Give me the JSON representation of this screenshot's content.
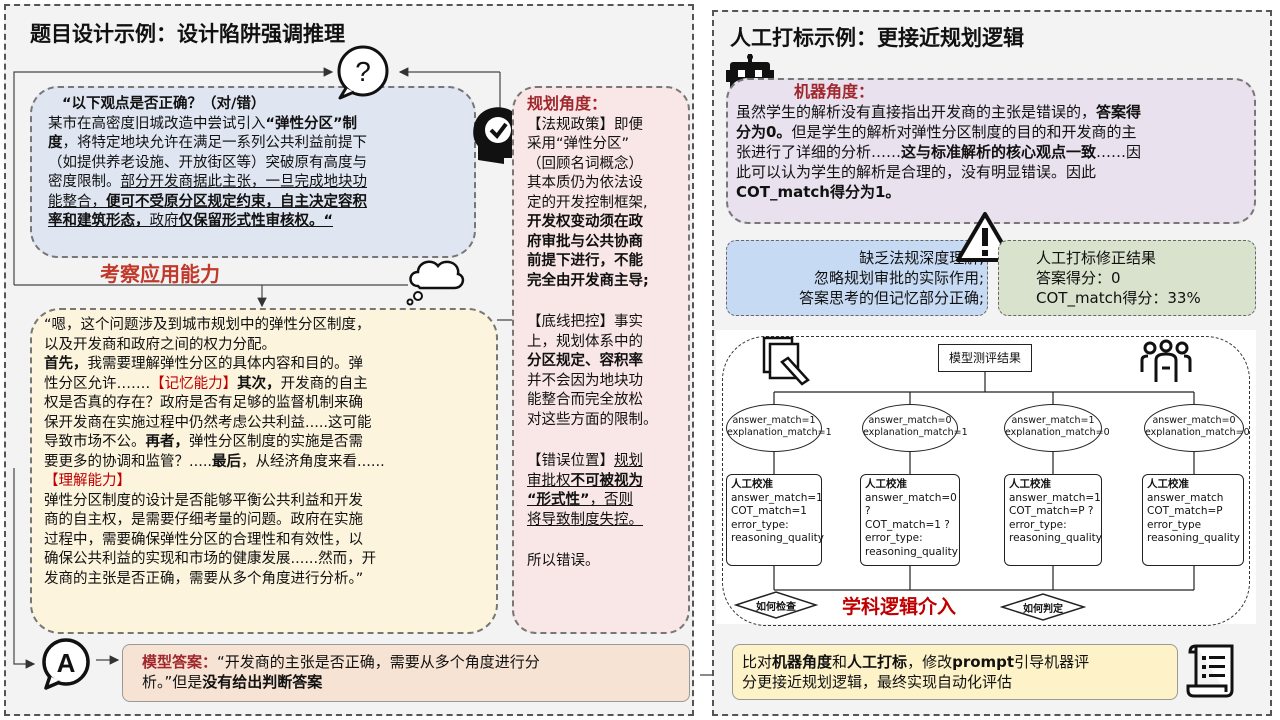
{
  "left_panel": {
    "title": "题目设计示例：设计陷阱强调推理",
    "question": {
      "l1": "“以下观点是否正确？（对/错）",
      "l2a": "某市在高密度旧城改造中尝试引入",
      "l2b": "“弹性分区”制",
      "l3a": "度",
      "l3b": "，将特定地块允许在满足一系列公共利益前提下",
      "l4": "（如提供养老设施、开放街区等）突破原有高度与",
      "l5": "密度限制。",
      "l5u": "部分开发商据此主张，一旦完成地块功",
      "l6a": "能整合，",
      "l6b": "便可不受原分区规定约束，自主决定容积",
      "l7a": "率和建筑形态，",
      "l7b": "政府",
      "l7c": "仅保留形式性审核权。“"
    },
    "ability_label": "考察应用能力",
    "reasoning": {
      "l1": "“嗯，这个问题涉及到城市规划中的弹性分区制度，",
      "l2": "以及开发商和政府之间的权力分配。",
      "l3a": "首先，",
      "l3b": "我需要理解弹性分区的具体内容和目的。弹",
      "l4a": "性分区允许…….",
      "l4b": "【记忆能力】",
      "l4c": "其次，",
      "l4d": "开发商的自主",
      "l5": "权是否真的存在？政府是否有足够的监督机制来确",
      "l6": "保开发商在实施过程中仍然考虑公共利益.....这可能",
      "l7a": "导致市场不公。",
      "l7b": "再者，",
      "l7c": "弹性分区制度的实施是否需",
      "l8a": "要更多的协调和监管？.....",
      "l8b": "最后",
      "l8c": "，从经济角度来看......",
      "l9": "【理解能力】",
      "l10": "弹性分区制度的设计是否能够平衡公共利益和开发",
      "l11": "商的自主权，是需要仔细考量的问题。政府在实施",
      "l12": "过程中，需要确保弹性分区的合理性和有效性，以",
      "l13": "确保公共利益的实现和市场的健康发展......然而，开",
      "l14": "发商的主张是否正确，需要从多个角度进行分析。”"
    },
    "planning": {
      "title": "规划角度：",
      "s1_l1": "【法规政策】即便",
      "s1_l2": "采用“弹性分区”",
      "s1_l3": "（回顾名词概念）",
      "s1_l4": "其本质仍为依法设",
      "s1_l5": "定的开发控制框架,",
      "s1_l6": "开发权变动须在政",
      "s1_l7": "府审批与公共协商",
      "s1_l8": "前提下进行，不能",
      "s1_l9": "完全由开发商主导;",
      "s2_l1": "【底线把控】事实",
      "s2_l2": "上，规划体系中的",
      "s2_l3": "分区规定、容积率",
      "s2_l4": "并不会因为地块功",
      "s2_l5": "能整合而完全放松",
      "s2_l6": "对这些方面的限制。",
      "s3_l1a": "【错误位置】",
      "s3_l1b": "规划",
      "s3_l2a": "审批权",
      "s3_l2b": "不可被视为",
      "s3_l3a": "“形式性”",
      "s3_l3b": "，否则",
      "s3_l4": "将导致制度失控。",
      "s4": "所以错误。"
    },
    "model_answer": {
      "label": "模型答案：",
      "l1": "“开发商的主张是否正确，需要从多个角度进行分",
      "l2a": "析。”但是",
      "l2b": "没有给出判断答案"
    },
    "icons": {
      "question": "?",
      "answer": "A"
    }
  },
  "right_panel": {
    "title": "人工打标示例：更接近规划逻辑",
    "machine": {
      "label": "机器角度：",
      "l1a": "虽然学生的解析没有直接指出开发商的主张是错误的，",
      "l1b": "答案得",
      "l2a": "分为0。",
      "l2b": "但是学生的解析对弹性分区制度的目的和开发商的主",
      "l3a": "张进行了详细的分析……",
      "l3b": "这与标准解析的核心观点一致",
      "l3c": "……因",
      "l4": "此可以认为学生的解析是合理的，没有明显错误。因此",
      "l5": "COT_match得分为1。"
    },
    "lack": {
      "l1": "缺乏法规深度理解,",
      "l2": "忽略规划审批的实际作用;",
      "l3": "答案思考的但记忆部分正确;"
    },
    "correction": {
      "l1": "人工打标修正结果",
      "l2": "答案得分：0",
      "l3": "COT_match得分：33%"
    },
    "flow": {
      "top": "模型测评结果",
      "ovals": [
        {
          "a": "answer_match=1",
          "b": "explanation_match=1"
        },
        {
          "a": "answer_match=0",
          "b": "explanation_match=1"
        },
        {
          "a": "answer_match=1",
          "b": "explanation_match=0"
        },
        {
          "a": "answer_match=0",
          "b": "explanation_match=0"
        }
      ],
      "results": [
        {
          "t": "人工校准",
          "a": "answer_match=1",
          "b": "COT_match=1",
          "c": "error_type:",
          "d": "reasoning_quality"
        },
        {
          "t": "人工校准",
          "a": "answer_match=0 ?",
          "b": "COT_match=1 ?",
          "c": "error_type:",
          "d": "reasoning_quality"
        },
        {
          "t": "人工校准",
          "a": "answer_match=1",
          "b": "COT_match=P ?",
          "c": "error_type:",
          "d": "reasoning_quality"
        },
        {
          "t": "人工校准",
          "a": "answer_match",
          "b": "COT_match=P",
          "c": "error_type",
          "d": "reasoning_quality"
        }
      ],
      "check": "如何检查",
      "judge": "如何判定",
      "logic": "学科逻辑介入"
    },
    "conclusion": {
      "l1a": "比对",
      "l1b": "机器角度",
      "l1c": "和",
      "l1d": "人工打标",
      "l1e": "，修改",
      "l1f": "prompt",
      "l1g": "引导机器评",
      "l2": "分更接近规划逻辑，最终实现自动化评估"
    }
  },
  "colors": {
    "question_bg": "#dfe6f2",
    "reason_bg": "#fcf4dd",
    "plan_bg": "#f9e6e6",
    "machine_bg": "#e9e1ee",
    "lack_bg": "#c7daf4",
    "correction_bg": "#d8e2cc",
    "answer_bg": "#f7e3d3",
    "conclusion_bg": "#fdf2c8",
    "accent_red": "#c00000"
  }
}
